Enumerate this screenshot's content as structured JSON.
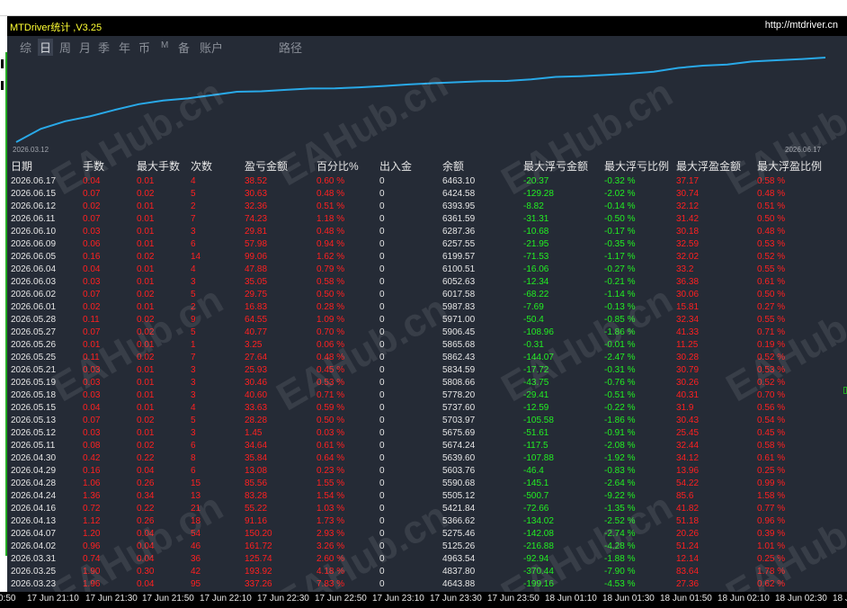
{
  "window": {
    "title": "MTDriver统计 ,V3.25",
    "url": "http://mtdriver.cn"
  },
  "tabs": [
    {
      "label": "综",
      "active": false
    },
    {
      "label": "日",
      "active": true
    },
    {
      "label": "周",
      "active": false
    },
    {
      "label": "月",
      "active": false
    },
    {
      "label": "季",
      "active": false
    },
    {
      "label": "年",
      "active": false
    },
    {
      "label": "币",
      "active": false
    },
    {
      "label": "M",
      "active": false
    },
    {
      "label": "备",
      "active": false
    },
    {
      "label": "账户",
      "active": false
    },
    {
      "label": "路径",
      "active": false
    }
  ],
  "chart": {
    "start_date": "2026.03.12",
    "end_date": "2026.06.17",
    "line_color": "#29a9e8"
  },
  "table": {
    "headers": [
      "日期",
      "手数",
      "最大手数",
      "次数",
      "盈亏金额",
      "百分比%",
      "出入金",
      "余额",
      "最大浮亏金额",
      "最大浮亏比例",
      "最大浮盈金额",
      "最大浮盈比例"
    ],
    "rows": [
      [
        "2026.06.17",
        "0.04",
        "0.01",
        "4",
        "38.52",
        "0.60 %",
        "0",
        "6463.10",
        "-20.37",
        "-0.32 %",
        "37.17",
        "0.58 %"
      ],
      [
        "2026.06.15",
        "0.07",
        "0.02",
        "5",
        "30.63",
        "0.48 %",
        "0",
        "6424.58",
        "-129.28",
        "-2.02 %",
        "30.74",
        "0.48 %"
      ],
      [
        "2026.06.12",
        "0.02",
        "0.01",
        "2",
        "32.36",
        "0.51 %",
        "0",
        "6393.95",
        "-8.82",
        "-0.14 %",
        "32.12",
        "0.51 %"
      ],
      [
        "2026.06.11",
        "0.07",
        "0.01",
        "7",
        "74.23",
        "1.18 %",
        "0",
        "6361.59",
        "-31.31",
        "-0.50 %",
        "31.42",
        "0.50 %"
      ],
      [
        "2026.06.10",
        "0.03",
        "0.01",
        "3",
        "29.81",
        "0.48 %",
        "0",
        "6287.36",
        "-10.68",
        "-0.17 %",
        "30.18",
        "0.48 %"
      ],
      [
        "2026.06.09",
        "0.06",
        "0.01",
        "6",
        "57.98",
        "0.94 %",
        "0",
        "6257.55",
        "-21.95",
        "-0.35 %",
        "32.59",
        "0.53 %"
      ],
      [
        "2026.06.05",
        "0.16",
        "0.02",
        "14",
        "99.06",
        "1.62 %",
        "0",
        "6199.57",
        "-71.53",
        "-1.17 %",
        "32.02",
        "0.52 %"
      ],
      [
        "2026.06.04",
        "0.04",
        "0.01",
        "4",
        "47.88",
        "0.79 %",
        "0",
        "6100.51",
        "-16.06",
        "-0.27 %",
        "33.2",
        "0.55 %"
      ],
      [
        "2026.06.03",
        "0.03",
        "0.01",
        "3",
        "35.05",
        "0.58 %",
        "0",
        "6052.63",
        "-12.34",
        "-0.21 %",
        "36.38",
        "0.61 %"
      ],
      [
        "2026.06.02",
        "0.07",
        "0.02",
        "5",
        "29.75",
        "0.50 %",
        "0",
        "6017.58",
        "-68.22",
        "-1.14 %",
        "30.06",
        "0.50 %"
      ],
      [
        "2026.06.01",
        "0.02",
        "0.01",
        "2",
        "16.83",
        "0.28 %",
        "0",
        "5987.83",
        "-7.69",
        "-0.13 %",
        "15.81",
        "0.27 %"
      ],
      [
        "2026.05.28",
        "0.11",
        "0.02",
        "9",
        "64.55",
        "1.09 %",
        "0",
        "5971.00",
        "-50.4",
        "-0.85 %",
        "32.34",
        "0.55 %"
      ],
      [
        "2026.05.27",
        "0.07",
        "0.02",
        "5",
        "40.77",
        "0.70 %",
        "0",
        "5906.45",
        "-108.96",
        "-1.86 %",
        "41.33",
        "0.71 %"
      ],
      [
        "2026.05.26",
        "0.01",
        "0.01",
        "1",
        "3.25",
        "0.06 %",
        "0",
        "5865.68",
        "-0.31",
        "-0.01 %",
        "11.25",
        "0.19 %"
      ],
      [
        "2026.05.25",
        "0.11",
        "0.02",
        "7",
        "27.64",
        "0.48 %",
        "0",
        "5862.43",
        "-144.07",
        "-2.47 %",
        "30.28",
        "0.52 %"
      ],
      [
        "2026.05.21",
        "0.03",
        "0.01",
        "3",
        "25.93",
        "0.45 %",
        "0",
        "5834.59",
        "-17.72",
        "-0.31 %",
        "30.79",
        "0.53 %"
      ],
      [
        "2026.05.19",
        "0.03",
        "0.01",
        "3",
        "30.46",
        "0.53 %",
        "0",
        "5808.66",
        "-43.75",
        "-0.76 %",
        "30.26",
        "0.52 %"
      ],
      [
        "2026.05.18",
        "0.03",
        "0.01",
        "3",
        "40.60",
        "0.71 %",
        "0",
        "5778.20",
        "-29.41",
        "-0.51 %",
        "40.31",
        "0.70 %"
      ],
      [
        "2026.05.15",
        "0.04",
        "0.01",
        "4",
        "33.63",
        "0.59 %",
        "0",
        "5737.60",
        "-12.59",
        "-0.22 %",
        "31.9",
        "0.56 %"
      ],
      [
        "2026.05.13",
        "0.07",
        "0.02",
        "5",
        "28.28",
        "0.50 %",
        "0",
        "5703.97",
        "-105.58",
        "-1.86 %",
        "30.43",
        "0.54 %"
      ],
      [
        "2026.05.12",
        "0.03",
        "0.01",
        "3",
        "1.45",
        "0.03 %",
        "0",
        "5675.69",
        "-51.61",
        "-0.91 %",
        "25.45",
        "0.45 %"
      ],
      [
        "2026.05.11",
        "0.08",
        "0.02",
        "6",
        "34.64",
        "0.61 %",
        "0",
        "5674.24",
        "-117.5",
        "-2.08 %",
        "32.44",
        "0.58 %"
      ],
      [
        "2026.04.30",
        "0.42",
        "0.22",
        "8",
        "35.84",
        "0.64 %",
        "0",
        "5639.60",
        "-107.88",
        "-1.92 %",
        "34.12",
        "0.61 %"
      ],
      [
        "2026.04.29",
        "0.16",
        "0.04",
        "6",
        "13.08",
        "0.23 %",
        "0",
        "5603.76",
        "-46.4",
        "-0.83 %",
        "13.96",
        "0.25 %"
      ],
      [
        "2026.04.28",
        "1.06",
        "0.26",
        "15",
        "85.56",
        "1.55 %",
        "0",
        "5590.68",
        "-145.1",
        "-2.64 %",
        "54.22",
        "0.99 %"
      ],
      [
        "2026.04.24",
        "1.36",
        "0.34",
        "13",
        "83.28",
        "1.54 %",
        "0",
        "5505.12",
        "-500.7",
        "-9.22 %",
        "85.6",
        "1.58 %"
      ],
      [
        "2026.04.16",
        "0.72",
        "0.22",
        "21",
        "55.22",
        "1.03 %",
        "0",
        "5421.84",
        "-72.66",
        "-1.35 %",
        "41.82",
        "0.77 %"
      ],
      [
        "2026.04.13",
        "1.12",
        "0.26",
        "18",
        "91.16",
        "1.73 %",
        "0",
        "5366.62",
        "-134.02",
        "-2.52 %",
        "51.18",
        "0.96 %"
      ],
      [
        "2026.04.07",
        "1.20",
        "0.04",
        "54",
        "150.20",
        "2.93 %",
        "0",
        "5275.46",
        "-142.08",
        "-2.74 %",
        "20.26",
        "0.39 %"
      ],
      [
        "2026.04.02",
        "0.96",
        "0.04",
        "46",
        "161.72",
        "3.26 %",
        "0",
        "5125.26",
        "-216.88",
        "-4.28 %",
        "51.24",
        "1.01 %"
      ],
      [
        "2026.03.31",
        "0.74",
        "0.04",
        "36",
        "125.74",
        "2.60 %",
        "0",
        "4963.54",
        "-92.94",
        "-1.88 %",
        "12.14",
        "0.25 %"
      ],
      [
        "2026.03.25",
        "1.90",
        "0.30",
        "42",
        "193.92",
        "4.18 %",
        "0",
        "4837.80",
        "-370.44",
        "-7.90 %",
        "83.64",
        "1.78 %"
      ],
      [
        "2026.03.23",
        "1.96",
        "0.04",
        "95",
        "337.26",
        "7.83 %",
        "0",
        "4643.88",
        "-199.16",
        "-4.53 %",
        "27.36",
        "0.62 %"
      ]
    ]
  },
  "time_axis": [
    "0:50",
    "17 Jun 21:10",
    "17 Jun 21:30",
    "17 Jun 21:50",
    "17 Jun 22:10",
    "17 Jun 22:30",
    "17 Jun 22:50",
    "17 Jun 23:10",
    "17 Jun 23:30",
    "17 Jun 23:50",
    "18 Jun 01:10",
    "18 Jun 01:30",
    "18 Jun 01:50",
    "18 Jun 02:10",
    "18 Jun 02:30",
    "18 J"
  ],
  "watermark": "EAHub.cn"
}
